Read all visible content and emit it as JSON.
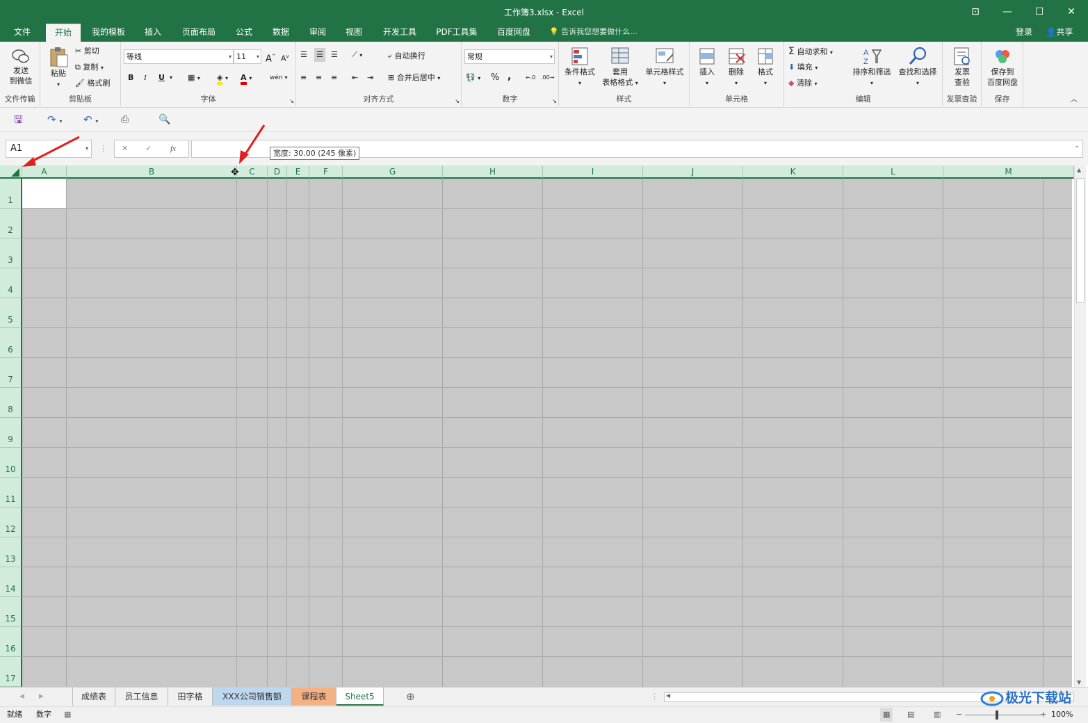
{
  "window": {
    "title": "工作簿3.xlsx - Excel",
    "controls": {
      "ribbon_display": "⊡",
      "minimize": "—",
      "maximize": "☐",
      "close": "✕"
    }
  },
  "menu_tabs": [
    "文件",
    "开始",
    "我的模板",
    "插入",
    "页面布局",
    "公式",
    "数据",
    "审阅",
    "视图",
    "开发工具",
    "PDF工具集",
    "百度网盘"
  ],
  "active_tab": "开始",
  "tell_me": "告诉我您想要做什么...",
  "account": {
    "login": "登录",
    "share": "共享"
  },
  "ribbon": {
    "file_transfer": {
      "send_label_1": "发送",
      "send_label_2": "到微信",
      "group": "文件传输"
    },
    "clipboard": {
      "paste": "粘贴",
      "cut": "剪切",
      "copy": "复制",
      "format_painter": "格式刷",
      "group": "剪贴板"
    },
    "font": {
      "font_name": "等线",
      "font_size": "11",
      "bold": "B",
      "italic": "I",
      "underline": "U",
      "grow": "A",
      "shrink": "A",
      "font_color": "A",
      "phonetic": "wén",
      "group": "字体"
    },
    "alignment": {
      "wrap_text": "自动换行",
      "merge_center": "合并后居中",
      "group": "对齐方式"
    },
    "number": {
      "format": "常规",
      "percent": "%",
      "comma": ",",
      "group": "数字"
    },
    "styles": {
      "conditional": "条件格式",
      "table_1": "套用",
      "table_2": "表格格式",
      "cell_styles": "单元格样式",
      "group": "样式"
    },
    "cells": {
      "insert": "插入",
      "delete": "删除",
      "format": "格式",
      "group": "单元格"
    },
    "editing": {
      "autosum": "自动求和",
      "fill": "填充",
      "clear": "清除",
      "sort_filter": "排序和筛选",
      "find_select": "查找和选择",
      "group": "编辑"
    },
    "invoice": {
      "check_1": "发票",
      "check_2": "查验",
      "group": "发票查验"
    },
    "save": {
      "baidu_1": "保存到",
      "baidu_2": "百度网盘",
      "group": "保存"
    }
  },
  "name_box": "A1",
  "formula_buttons": {
    "cancel": "✕",
    "enter": "✓",
    "fx": "fx"
  },
  "formula_value": "",
  "tooltip": "宽度: 30.00 (245 像素)",
  "columns": [
    "A",
    "B",
    "C",
    "D",
    "E",
    "F",
    "G",
    "H",
    "I",
    "J",
    "K",
    "L",
    "M"
  ],
  "rows": [
    "1",
    "2",
    "3",
    "4",
    "5",
    "6",
    "7",
    "8",
    "9",
    "10",
    "11",
    "12",
    "13",
    "14",
    "15",
    "16",
    "17"
  ],
  "sheet_tabs": [
    {
      "label": "成绩表",
      "color": ""
    },
    {
      "label": "员工信息",
      "color": ""
    },
    {
      "label": "田字格",
      "color": ""
    },
    {
      "label": "XXX公司销售额",
      "color": "#bdd7ee"
    },
    {
      "label": "课程表",
      "color": "#f4b183"
    },
    {
      "label": "Sheet5",
      "color": "",
      "active": true
    }
  ],
  "status": {
    "ready": "就绪",
    "mode": "数字",
    "zoom": "100%"
  },
  "watermark": "极光下载站",
  "colors": {
    "excel_green": "#217346",
    "header_bg": "#d2ecdc",
    "cell_bg": "#c8c8c8",
    "arrow": "#e02020"
  }
}
